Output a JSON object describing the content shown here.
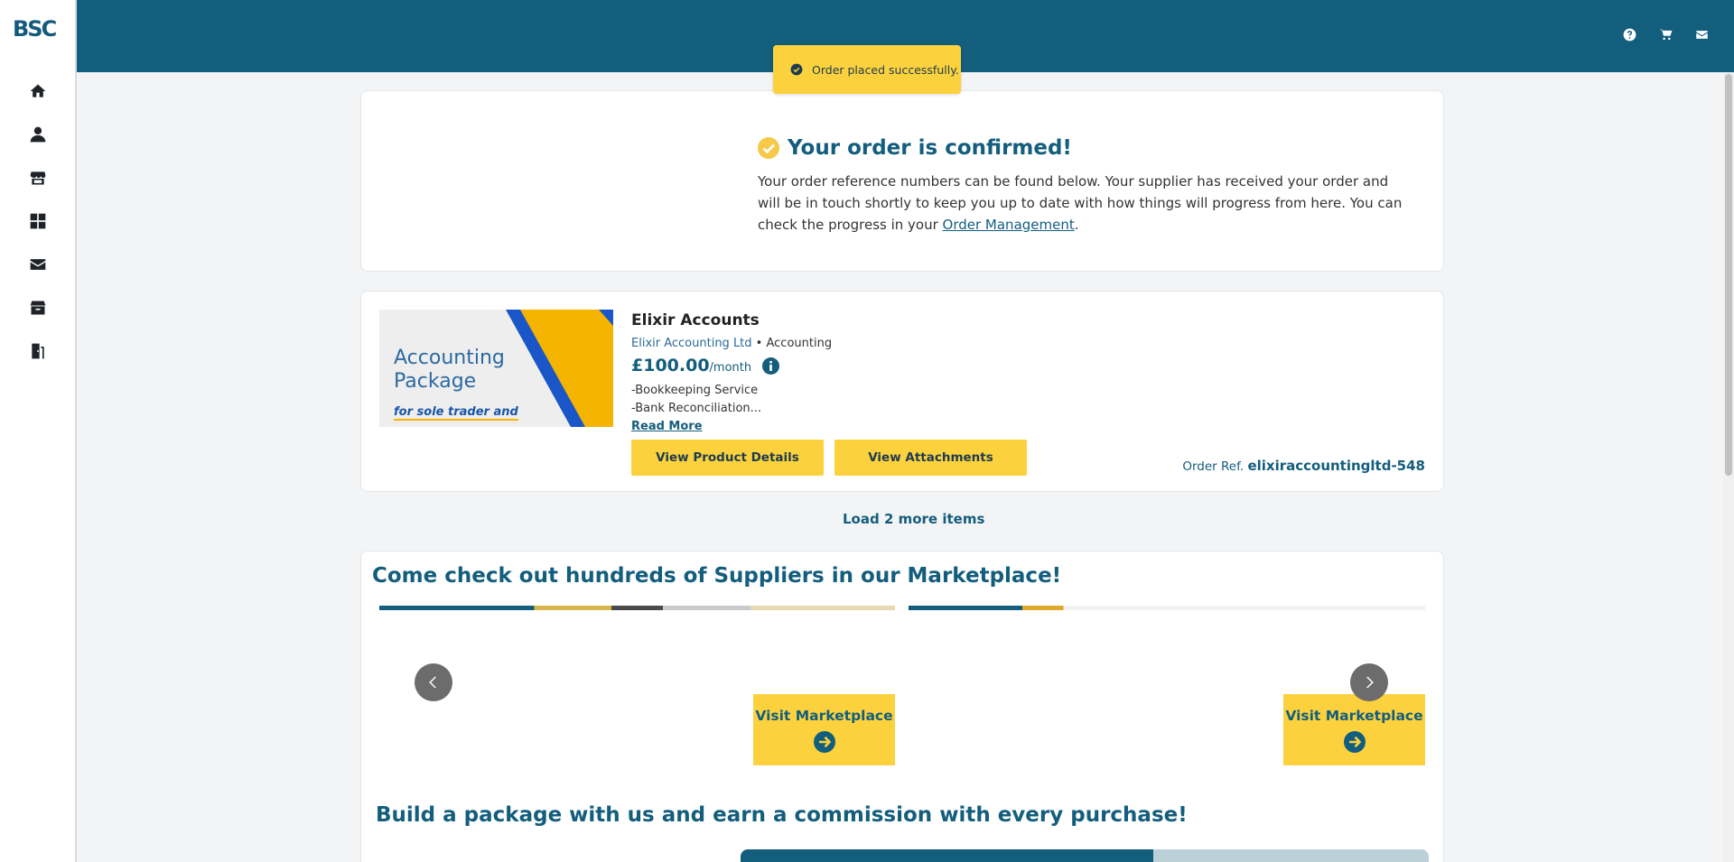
{
  "sidebar": {
    "logo": "BSC",
    "items": [
      {
        "icon": "home-icon"
      },
      {
        "icon": "user-icon"
      },
      {
        "icon": "store-icon"
      },
      {
        "icon": "dashboard-grid-icon"
      },
      {
        "icon": "envelope-icon"
      },
      {
        "icon": "box-icon"
      },
      {
        "icon": "logout-door-icon"
      }
    ]
  },
  "header": {
    "icons": [
      "help-icon",
      "cart-icon",
      "envelope-icon"
    ]
  },
  "toast": {
    "message": "Order placed successfully."
  },
  "confirmation": {
    "title": "Your order is confirmed!",
    "body_before_link": "Your order reference numbers can be found below. Your supplier has received your order and will be in touch shortly to keep you up to date with how things will progress from here. You can check the progress in your ",
    "link_text": "Order Management",
    "body_after_link": "."
  },
  "product": {
    "image_title_line1": "Accounting",
    "image_title_line2": "Package",
    "image_subtitle": "for sole trader and",
    "name": "Elixir Accounts",
    "supplier": "Elixir Accounting Ltd",
    "separator": " • ",
    "category": "Accounting",
    "price": "£100.00",
    "price_period": "/month",
    "description_line1": "-Bookkeeping Service",
    "description_line2": "-Bank Reconciliation...",
    "read_more": "Read More",
    "view_details_label": "View Product Details",
    "view_attachments_label": "View Attachments",
    "order_ref_label": "Order Ref.",
    "order_ref_value": "elixiraccountingltd-548"
  },
  "load_more": "Load 2 more items",
  "marketplace": {
    "title": "Come check out hundreds of Suppliers in our Marketplace!",
    "visit_label": "Visit Marketplace",
    "visit_label_2": "Visit Marketplace"
  },
  "build": {
    "title": "Build a package with us and earn a commission with every purchase!"
  },
  "colors": {
    "primary": "#135d7d",
    "accent": "#fbd23e",
    "background": "#f3f4f6"
  }
}
